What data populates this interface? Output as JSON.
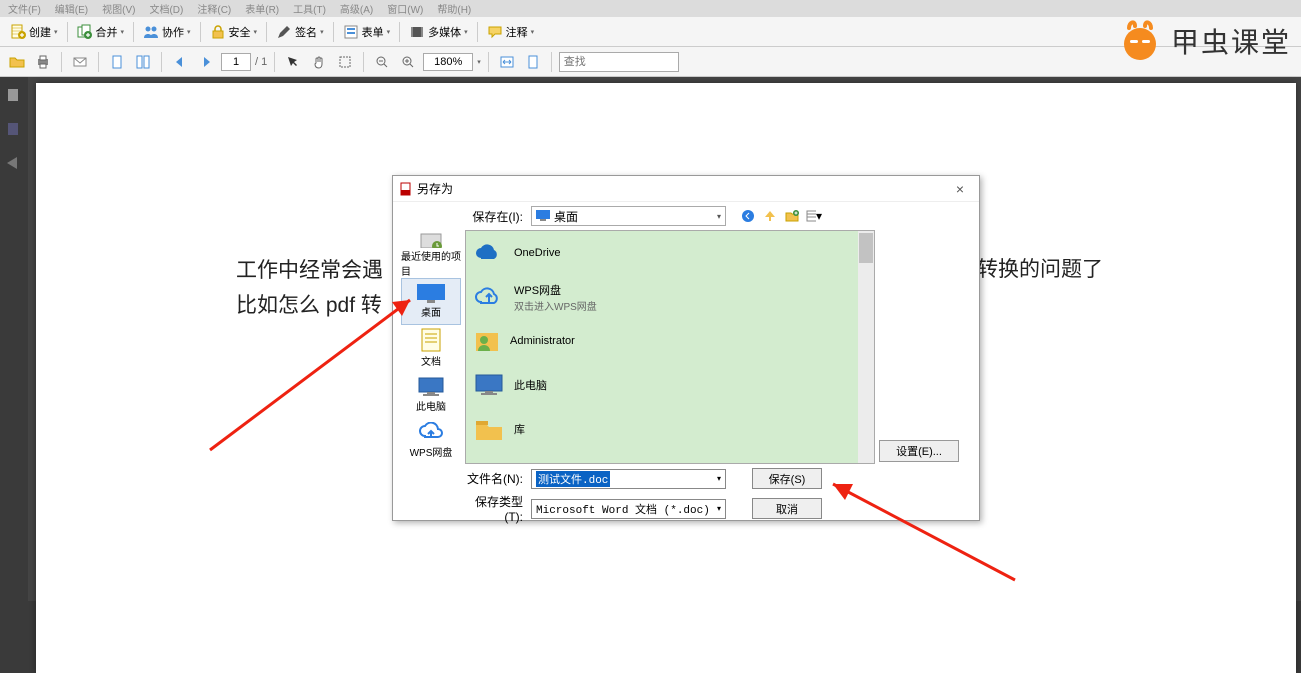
{
  "menu": {
    "file": "文件(F)",
    "edit": "编辑(E)",
    "view": "视图(V)",
    "document": "文档(D)",
    "comment": "注释(C)",
    "form": "表单(R)",
    "tool": "工具(T)",
    "advanced": "高级(A)",
    "window": "窗口(W)",
    "help": "帮助(H)"
  },
  "tb1": {
    "create": "创建",
    "merge": "合并",
    "collab": "协作",
    "secure": "安全",
    "sign": "签名",
    "form": "表单",
    "media": "多媒体",
    "note": "注释"
  },
  "tb2": {
    "page": "1",
    "total": "/ 1",
    "zoom": "180%",
    "find": "查找"
  },
  "brand": "甲虫课堂",
  "page_text": {
    "line1a": "工作中经常会遇",
    "line1b": "式转换的问题了",
    "line2": "比如怎么 pdf 转"
  },
  "dlg": {
    "title": "另存为",
    "save_in": "保存在(I):",
    "loc": "桌面",
    "places": {
      "recent": "最近使用的项目",
      "desktop": "桌面",
      "docs": "文档",
      "pc": "此电脑",
      "wps": "WPS网盘"
    },
    "items": {
      "onedrive": "OneDrive",
      "wps": "WPS网盘",
      "wps_sub": "双击进入WPS网盘",
      "admin": "Administrator",
      "pc": "此电脑",
      "lib": "库"
    },
    "settings": "设置(E)...",
    "fname_lbl": "文件名(N):",
    "fname": "测试文件.doc",
    "ftype_lbl": "保存类型(T):",
    "ftype": "Microsoft Word 文档 (*.doc)",
    "save": "保存(S)",
    "cancel": "取消"
  }
}
